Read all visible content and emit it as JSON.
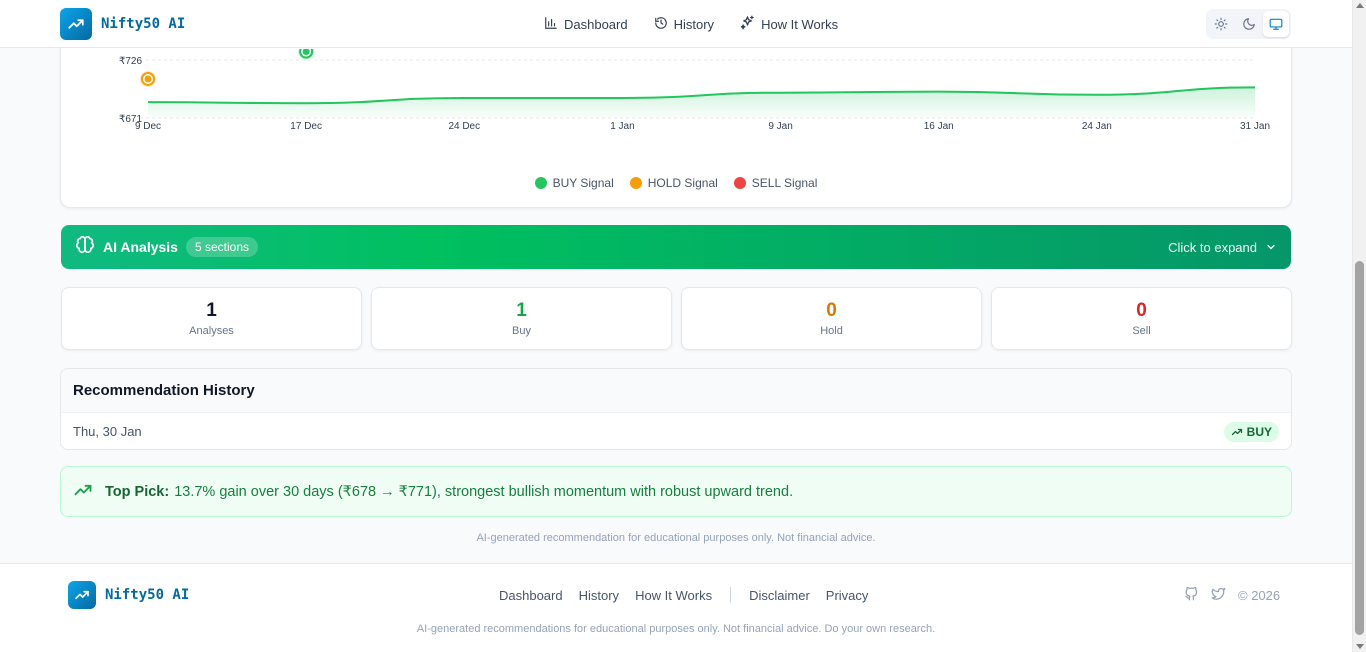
{
  "header": {
    "brand": "Nifty50 AI",
    "nav": [
      {
        "label": "Dashboard",
        "icon": "bar-chart-icon"
      },
      {
        "label": "History",
        "icon": "history-icon"
      },
      {
        "label": "How It Works",
        "icon": "sparkles-icon"
      }
    ],
    "theme_options": [
      "light",
      "dark",
      "system"
    ],
    "theme_active": "system"
  },
  "chart_data": {
    "type": "line",
    "x": [
      "9 Dec",
      "17 Dec",
      "24 Dec",
      "1 Jan",
      "9 Jan",
      "16 Jan",
      "24 Jan",
      "31 Jan"
    ],
    "x_tick_labels": [
      "9 Dec",
      "17 Dec",
      "24 Dec",
      "1 Jan",
      "9 Jan",
      "16 Jan",
      "24 Jan",
      "31 Jan"
    ],
    "y_tick_labels": [
      "₹726",
      "₹671"
    ],
    "series": [
      {
        "values": [
          686,
          685,
          690,
          690,
          695,
          696,
          693,
          700
        ]
      }
    ],
    "signals": [
      {
        "type": "HOLD",
        "x": "9 Dec",
        "y": 708
      },
      {
        "type": "BUY",
        "x": "17 Dec",
        "y": 734
      }
    ],
    "legend": [
      {
        "label": "BUY Signal",
        "color": "#22c55e"
      },
      {
        "label": "HOLD Signal",
        "color": "#f59e0b"
      },
      {
        "label": "SELL Signal",
        "color": "#ef4444"
      }
    ],
    "legend_position": "bottom",
    "ylim": [
      671,
      726
    ],
    "grid": true,
    "line_color": "#22c55e"
  },
  "ai_analysis": {
    "title": "AI Analysis",
    "badge": "5 sections",
    "expand_label": "Click to expand"
  },
  "stats": [
    {
      "value": "1",
      "label": "Analyses",
      "color": "#0f172a"
    },
    {
      "value": "1",
      "label": "Buy",
      "color": "#16a34a"
    },
    {
      "value": "0",
      "label": "Hold",
      "color": "#d97706"
    },
    {
      "value": "0",
      "label": "Sell",
      "color": "#dc2626"
    }
  ],
  "history": {
    "title": "Recommendation History",
    "rows": [
      {
        "date": "Thu, 30 Jan",
        "signal": "BUY"
      }
    ]
  },
  "top_pick": {
    "label": "Top Pick:",
    "text": "13.7% gain over 30 days (₹678 → ₹771), strongest bullish momentum with robust upward trend."
  },
  "disclaimer": "AI-generated recommendation for educational purposes only. Not financial advice.",
  "footer": {
    "brand": "Nifty50 AI",
    "links": [
      "Dashboard",
      "History",
      "How It Works"
    ],
    "legal_links": [
      "Disclaimer",
      "Privacy"
    ],
    "copyright": "© 2026",
    "social": [
      "github-icon",
      "twitter-icon"
    ],
    "disclaimer": "AI-generated recommendations for educational purposes only. Not financial advice. Do your own research."
  },
  "colors": {
    "accent": "#0369a1",
    "buy": "#22c55e",
    "hold": "#f59e0b",
    "sell": "#ef4444"
  }
}
